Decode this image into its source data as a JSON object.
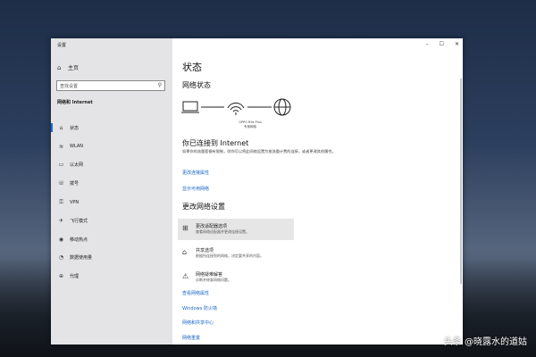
{
  "window": {
    "title": "设置",
    "controls": {
      "minimize": "–",
      "maximize": "☐",
      "close": "✕"
    }
  },
  "sidebar": {
    "home": "主页",
    "search_placeholder": "查找设置",
    "section": "网络和 Internet",
    "items": [
      {
        "label": "状态",
        "icon": "status-icon",
        "glyph": "⌂",
        "active": true
      },
      {
        "label": "WLAN",
        "icon": "wifi-icon",
        "glyph": "≋",
        "active": false
      },
      {
        "label": "以太网",
        "icon": "ethernet-icon",
        "glyph": "▭",
        "active": false
      },
      {
        "label": "拨号",
        "icon": "dialup-icon",
        "glyph": "☏",
        "active": false
      },
      {
        "label": "VPN",
        "icon": "vpn-icon",
        "glyph": "⚿",
        "active": false
      },
      {
        "label": "飞行模式",
        "icon": "airplane-icon",
        "glyph": "✈",
        "active": false
      },
      {
        "label": "移动热点",
        "icon": "hotspot-icon",
        "glyph": "◉",
        "active": false
      },
      {
        "label": "数据使用量",
        "icon": "data-usage-icon",
        "glyph": "◔",
        "active": false
      },
      {
        "label": "代理",
        "icon": "proxy-icon",
        "glyph": "⊕",
        "active": false
      }
    ]
  },
  "main": {
    "title": "状态",
    "network_status_heading": "网络状态",
    "device_name": "OPPO R9s Plus",
    "device_sub": "专用网络",
    "connected_heading": "你已连接到 Internet",
    "connected_desc": "如果你的流量套餐有限制，则你可以将此网络设置为按流量计费的连接，或者更改其他属性。",
    "links_top": [
      "更改连接属性",
      "显示可用网络"
    ],
    "change_heading": "更改网络设置",
    "options": [
      {
        "title": "更改适配器选项",
        "desc": "查看网络适配器并更改连接设置。",
        "icon": "adapter-icon",
        "glyph": "⊞"
      },
      {
        "title": "共享选项",
        "desc": "根据所连接到的网络，决定要共享的内容。",
        "icon": "share-icon",
        "glyph": "⌂"
      },
      {
        "title": "网络疑难解答",
        "desc": "诊断并修复网络问题。",
        "icon": "troubleshoot-icon",
        "glyph": "⚠"
      }
    ],
    "links_bottom": [
      "查看网络属性",
      "Windows 防火墙",
      "网络和共享中心",
      "网络重置"
    ]
  },
  "watermark": "头条 @晓露水的道姑",
  "colors": {
    "accent": "#1766c9",
    "sidebar_bg": "#e4e4e6"
  }
}
